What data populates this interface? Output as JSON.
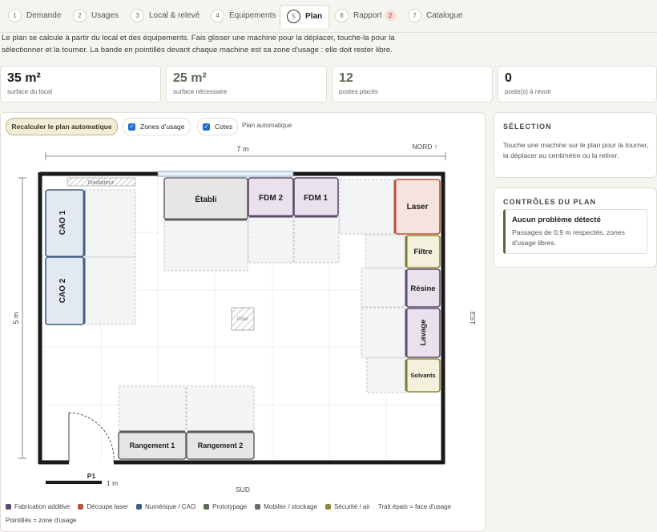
{
  "tabs": [
    {
      "num": "1",
      "label": "Demande"
    },
    {
      "num": "2",
      "label": "Usages"
    },
    {
      "num": "3",
      "label": "Local & relevé"
    },
    {
      "num": "4",
      "label": "Équipements"
    },
    {
      "num": "5",
      "label": "Plan",
      "active": true
    },
    {
      "num": "6",
      "label": "Rapport",
      "badge": "2"
    },
    {
      "num": "7",
      "label": "Catalogue"
    }
  ],
  "intro": "Le plan se calcule à partir du local et des équipements. Fais glisser une machine pour la déplacer, touche-la pour la sélectionner et la tourner. La bande en pointillés devant chaque machine est sa zone d'usage : elle doit rester libre.",
  "stats": [
    {
      "value": "35 m²",
      "label": "surface du local"
    },
    {
      "value": "25 m²",
      "label": "surface nécessaire"
    },
    {
      "value": "12",
      "label": "postes placés"
    },
    {
      "value": "0",
      "label": "poste(s) à revoir"
    }
  ],
  "toolbar": {
    "recalc_label": "Recalculer le plan automatique",
    "zones_label": "Zones d'usage",
    "zones_checked": true,
    "cotes_label": "Cotes",
    "cotes_checked": true,
    "auto_label": "Plan automatique"
  },
  "plan": {
    "width_label": "7 m",
    "height_label": "5 m",
    "north": "NORD ↑",
    "south": "SUD",
    "east": "EST",
    "radiator": "Radiateur",
    "pillar": "Pilier",
    "door": "P1",
    "scale": "1 m",
    "machines": [
      "CAO 1",
      "CAO 2",
      "Établi",
      "FDM 2",
      "FDM 1",
      "Laser",
      "Filtre",
      "Résine",
      "Lavage",
      "Solvants",
      "Rangement 1",
      "Rangement 2"
    ]
  },
  "legend": [
    {
      "label": "Fabrication additive",
      "color": "#5b4a6b"
    },
    {
      "label": "Découpe laser",
      "color": "#b5543c"
    },
    {
      "label": "Numérique / CAO",
      "color": "#3f5e82"
    },
    {
      "label": "Prototypage",
      "color": "#5a6b52"
    },
    {
      "label": "Mobilier / stockage",
      "color": "#6b6b6b"
    },
    {
      "label": "Sécurité / air",
      "color": "#8a8a3a"
    }
  ],
  "legend_note": "Trait épais = face d'usage",
  "legend_note2": "Pointillés = zone d'usage",
  "selection": {
    "title": "SÉLECTION",
    "text": "Touche une machine sur le plan pour la tourner, la déplacer au centimètre ou la retirer."
  },
  "controls": {
    "title": "CONTRÔLES DU PLAN",
    "status": "Aucun problème détecté",
    "detail": "Passages de 0,9 m respectés, zones d'usage libres."
  }
}
